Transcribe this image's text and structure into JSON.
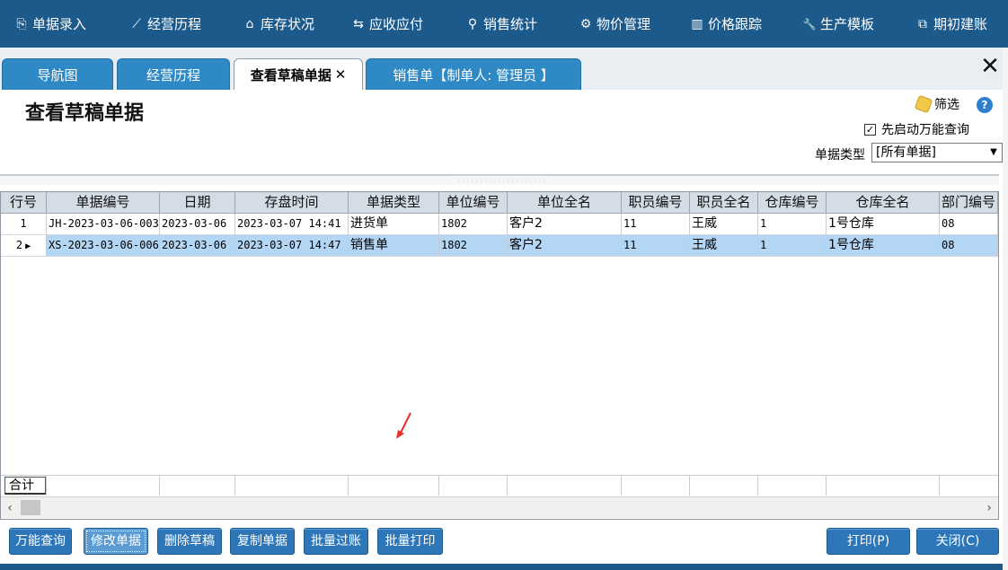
{
  "menu": {
    "items": [
      {
        "label": "单据录入",
        "icon": "document-entry-icon",
        "glyph": "⎘"
      },
      {
        "label": "经营历程",
        "icon": "line-chart-icon",
        "glyph": "⟋"
      },
      {
        "label": "库存状况",
        "icon": "home-icon",
        "glyph": "⌂"
      },
      {
        "label": "应收应付",
        "icon": "exchange-arrows-icon",
        "glyph": "⇆"
      },
      {
        "label": "销售统计",
        "icon": "search-icon",
        "glyph": "⚲"
      },
      {
        "label": "物价管理",
        "icon": "gear-icon",
        "glyph": "⚙"
      },
      {
        "label": "价格跟踪",
        "icon": "bar-chart-icon",
        "glyph": "▥"
      },
      {
        "label": "生产模板",
        "icon": "wrench-icon",
        "glyph": "🔧"
      },
      {
        "label": "期初建账",
        "icon": "external-link-icon",
        "glyph": "⧉"
      }
    ]
  },
  "tabs": [
    {
      "label": "导航图"
    },
    {
      "label": "经营历程"
    },
    {
      "label": "查看草稿单据",
      "close": "✕"
    },
    {
      "label": "销售单【制单人: 管理员 】"
    }
  ],
  "window_close": "✕",
  "page": {
    "title": "查看草稿单据",
    "filter_label": "筛选",
    "help_glyph": "?",
    "checkbox_label": "先启动万能查询",
    "checkbox_checked": true,
    "checkbox_mark": "✓",
    "doc_type_label": "单据类型",
    "doc_type_value": "[所有单据]",
    "dropdown_glyph": "▼"
  },
  "grid": {
    "headers": [
      "行号",
      "单据编号",
      "日期",
      "存盘时间",
      "单据类型",
      "单位编号",
      "单位全名",
      "职员编号",
      "职员全名",
      "仓库编号",
      "仓库全名",
      "部门编号"
    ],
    "rows": [
      {
        "row_no": "1",
        "doc_no": "JH-2023-03-06-003",
        "date": "2023-03-06",
        "saved_at": "2023-03-07 14:41",
        "doc_type": "进货单",
        "unit_no": "1802",
        "unit_name": "客户2",
        "staff_no": "11",
        "staff_name": "王威",
        "wh_no": "1",
        "wh_name": "1号仓库",
        "dept_no": "08"
      },
      {
        "row_no": "2",
        "doc_no": "XS-2023-03-06-006",
        "date": "2023-03-06",
        "saved_at": "2023-03-07 14:47",
        "doc_type": "销售单",
        "unit_no": "1802",
        "unit_name": "客户2",
        "staff_no": "11",
        "staff_name": "王威",
        "wh_no": "1",
        "wh_name": "1号仓库",
        "dept_no": "08"
      }
    ],
    "selected_row": 2,
    "row_marker_glyph": "▶",
    "total_label": "合计",
    "scroll_left": "‹",
    "scroll_right": "›"
  },
  "buttons": {
    "query": "万能查询",
    "edit": "修改单据",
    "delete": "删除草稿",
    "copy": "复制单据",
    "batch_post": "批量过账",
    "batch_print": "批量打印",
    "print": "打印(P)",
    "close": "关闭(C)"
  },
  "colors": {
    "topbar": "#1d5a8c",
    "tab_blue": "#2f89c5",
    "selected_row": "#b3d6f5",
    "header_bg": "#d4dde6",
    "annotation_arrow": "#e8312a"
  }
}
